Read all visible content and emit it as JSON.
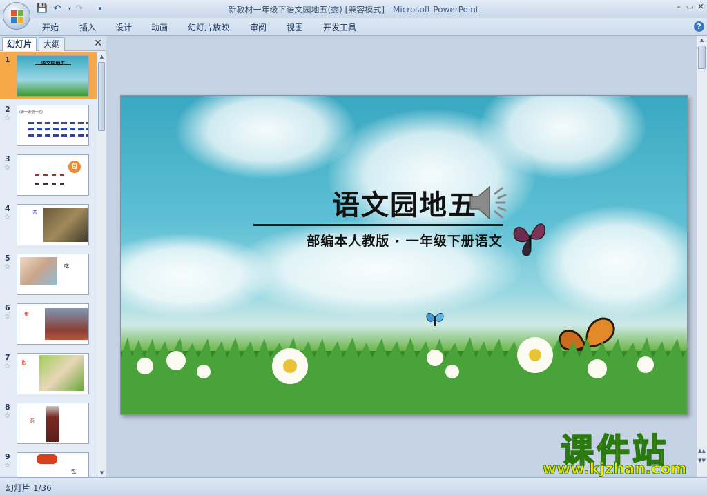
{
  "window": {
    "title": "新教材一年级下语文园地五(委) [兼容模式] - ",
    "app_name": "Microsoft PowerPoint",
    "minimize": "–",
    "restore": "▭",
    "close": "✕"
  },
  "quick_access": [
    "save-icon",
    "undo-icon",
    "redo-icon",
    "customize-icon"
  ],
  "ribbon": {
    "tabs": [
      "开始",
      "插入",
      "设计",
      "动画",
      "幻灯片放映",
      "审阅",
      "视图",
      "开发工具"
    ],
    "help": "?"
  },
  "panel": {
    "tabs": [
      "幻灯片",
      "大纲"
    ],
    "close": "✕",
    "thumbnails": [
      {
        "num": "1",
        "star": ""
      },
      {
        "num": "2",
        "star": "☆"
      },
      {
        "num": "3",
        "star": "☆"
      },
      {
        "num": "4",
        "star": "☆"
      },
      {
        "num": "5",
        "star": "☆"
      },
      {
        "num": "6",
        "star": "☆"
      },
      {
        "num": "7",
        "star": "☆"
      },
      {
        "num": "8",
        "star": "☆"
      },
      {
        "num": "9",
        "star": "☆"
      }
    ],
    "thumb_texts": {
      "t2_label": "(读一读记一记)",
      "t3_badge": "包",
      "t4_word": "茶",
      "t5_word": "吃",
      "t6_word": "步",
      "t7_word": "抱",
      "t8_word": "衣",
      "t9_word": "包"
    }
  },
  "slide": {
    "title": "语文园地五",
    "subtitle": "部编本人教版 · 一年级下册语文"
  },
  "status": {
    "slide_counter": "幻灯片 1/36"
  },
  "watermark": {
    "brand": "课件站",
    "url": "www.kjzhan.com"
  },
  "colors": {
    "selected_thumb": "#f7a94a",
    "sky": "#39a8c2",
    "grass": "#2f8a2a",
    "watermark": "#f4e400"
  }
}
